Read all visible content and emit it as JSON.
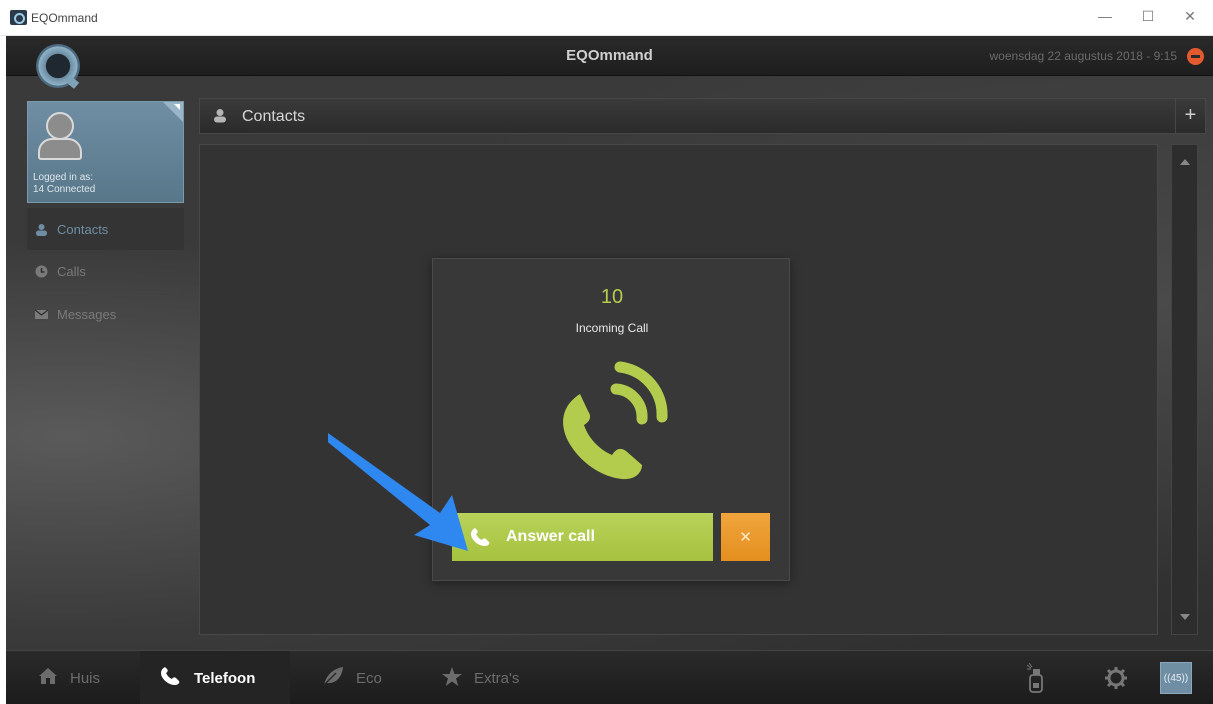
{
  "window": {
    "title": "EQOmmand",
    "min": "—",
    "max": "☐",
    "close": "✕"
  },
  "topbar": {
    "app_title": "EQOmmand",
    "datetime": "woensdag 22 augustus 2018 - 9:15"
  },
  "user": {
    "label_line1": "Logged in as:",
    "label_line2": "14 Connected"
  },
  "sidebar": {
    "items": [
      {
        "label": "Contacts",
        "icon": "person-icon",
        "active": true
      },
      {
        "label": "Calls",
        "icon": "clock-icon",
        "active": false
      },
      {
        "label": "Messages",
        "icon": "envelope-icon",
        "active": false
      }
    ]
  },
  "content": {
    "header_title": "Contacts",
    "add_label": "+"
  },
  "call": {
    "count": "10",
    "status": "Incoming Call",
    "answer_label": "Answer call",
    "decline_label": "✕",
    "answer_color": "#a6c23e",
    "decline_color": "#e48f1f"
  },
  "bottom_tabs": [
    {
      "label": "Huis",
      "icon": "house-icon"
    },
    {
      "label": "Telefoon",
      "icon": "phone-icon",
      "active": true
    },
    {
      "label": "Eco",
      "icon": "leaf-icon"
    },
    {
      "label": "Extra's",
      "icon": "star-icon"
    }
  ],
  "bottom_right": {
    "badge": "((45))"
  },
  "colors": {
    "accent_blue": "#6f8ea4",
    "green": "#b4cc4e",
    "orange": "#e48f1f",
    "power_red": "#e45a2f"
  }
}
